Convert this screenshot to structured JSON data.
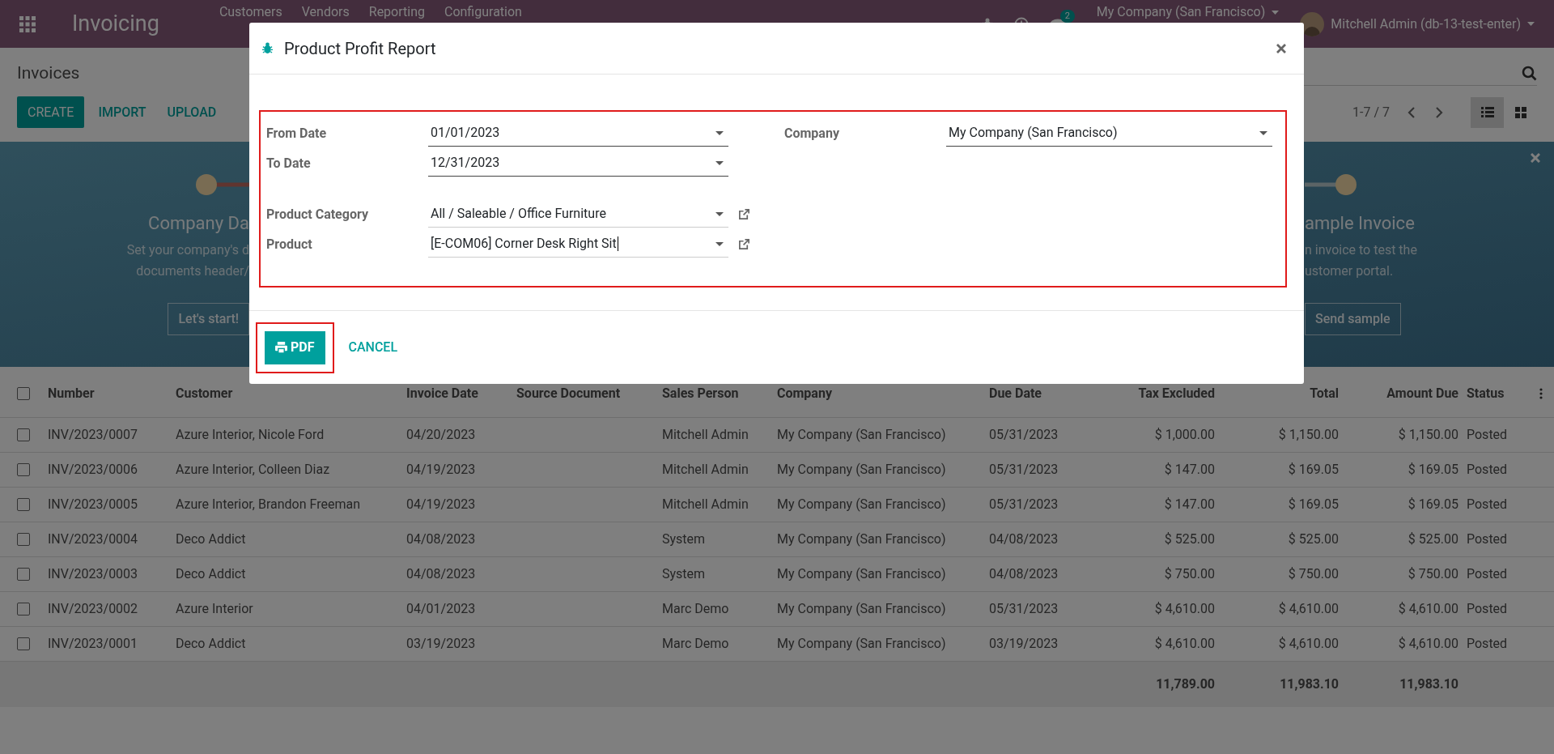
{
  "navbar": {
    "app_name": "Invoicing",
    "menu": [
      "Customers",
      "Vendors",
      "Reporting",
      "Configuration"
    ],
    "messages_badge": "2",
    "company": "My Company (San Francisco)",
    "user": "Mitchell Admin (db-13-test-enter)"
  },
  "control_panel": {
    "breadcrumb": "Invoices",
    "buttons": [
      {
        "label": "CREATE",
        "kind": "primary"
      },
      {
        "label": "IMPORT",
        "kind": "link"
      },
      {
        "label": "UPLOAD",
        "kind": "link"
      }
    ],
    "pager": "1-7 / 7",
    "views": [
      {
        "kind": "list",
        "selected": true
      },
      {
        "kind": "kanban",
        "selected": false
      }
    ]
  },
  "onboarding": {
    "steps": [
      {
        "title": "Company Da",
        "lines": [
          "Set your company's d",
          "documents header/"
        ],
        "button": "Let's start!"
      },
      {
        "title": "ample Invoice",
        "lines": [
          "n invoice to test the",
          "ustomer portal."
        ],
        "button": "Send sample"
      }
    ]
  },
  "table": {
    "all_checked": false,
    "columns": [
      {
        "label": "Number",
        "kind": "text"
      },
      {
        "label": "Customer",
        "kind": "text"
      },
      {
        "label": "Invoice Date",
        "kind": "text"
      },
      {
        "label": "Source Document",
        "kind": "text"
      },
      {
        "label": "Sales Person",
        "kind": "text"
      },
      {
        "label": "Company",
        "kind": "text"
      },
      {
        "label": "Due Date",
        "kind": "text"
      },
      {
        "label": "Tax Excluded",
        "kind": "amount"
      },
      {
        "label": "Total",
        "kind": "amount"
      },
      {
        "label": "Amount Due",
        "kind": "amount"
      },
      {
        "label": "Status",
        "kind": "text"
      }
    ],
    "rows": [
      {
        "checked": false,
        "cells": [
          "INV/2023/0007",
          "Azure Interior, Nicole Ford",
          "04/20/2023",
          "",
          "Mitchell Admin",
          "My Company (San Francisco)",
          "05/31/2023",
          "$ 1,000.00",
          "$ 1,150.00",
          "$ 1,150.00",
          "Posted"
        ]
      },
      {
        "checked": false,
        "cells": [
          "INV/2023/0006",
          "Azure Interior, Colleen Diaz",
          "04/19/2023",
          "",
          "Mitchell Admin",
          "My Company (San Francisco)",
          "05/31/2023",
          "$ 147.00",
          "$ 169.05",
          "$ 169.05",
          "Posted"
        ]
      },
      {
        "checked": false,
        "cells": [
          "INV/2023/0005",
          "Azure Interior, Brandon Freeman",
          "04/19/2023",
          "",
          "Mitchell Admin",
          "My Company (San Francisco)",
          "05/31/2023",
          "$ 147.00",
          "$ 169.05",
          "$ 169.05",
          "Posted"
        ]
      },
      {
        "checked": false,
        "cells": [
          "INV/2023/0004",
          "Deco Addict",
          "04/08/2023",
          "",
          "System",
          "My Company (San Francisco)",
          "04/08/2023",
          "$ 525.00",
          "$ 525.00",
          "$ 525.00",
          "Posted"
        ]
      },
      {
        "checked": false,
        "cells": [
          "INV/2023/0003",
          "Deco Addict",
          "04/08/2023",
          "",
          "System",
          "My Company (San Francisco)",
          "04/08/2023",
          "$ 750.00",
          "$ 750.00",
          "$ 750.00",
          "Posted"
        ]
      },
      {
        "checked": false,
        "cells": [
          "INV/2023/0002",
          "Azure Interior",
          "04/01/2023",
          "",
          "Marc Demo",
          "My Company (San Francisco)",
          "05/31/2023",
          "$ 4,610.00",
          "$ 4,610.00",
          "$ 4,610.00",
          "Posted"
        ]
      },
      {
        "checked": false,
        "cells": [
          "INV/2023/0001",
          "Deco Addict",
          "03/19/2023",
          "",
          "Marc Demo",
          "My Company (San Francisco)",
          "03/19/2023",
          "$ 4,610.00",
          "$ 4,610.00",
          "$ 4,610.00",
          "Posted"
        ]
      }
    ],
    "totals": {
      "tax_excluded": "11,789.00",
      "total": "11,983.10",
      "amount_due": "11,983.10"
    }
  },
  "dialog": {
    "title": "Product Profit Report",
    "left_groups": [
      [
        {
          "label": "From Date",
          "value": "01/01/2023",
          "kind": "date",
          "focused": false
        },
        {
          "label": "To Date",
          "value": "12/31/2023",
          "kind": "date",
          "focused": false
        }
      ],
      [
        {
          "label": "Product Category",
          "value": "All / Saleable / Office Furniture",
          "kind": "many2one",
          "focused": false
        },
        {
          "label": "Product",
          "value": "[E-COM06] Corner Desk Right Sit",
          "kind": "many2one",
          "focused": true
        }
      ]
    ],
    "right_fields": [
      {
        "label": "Company",
        "value": "My Company (San Francisco)",
        "kind": "select",
        "focused": false
      }
    ],
    "buttons": [
      {
        "label": "PDF",
        "kind": "primary"
      },
      {
        "label": "CANCEL",
        "kind": "link"
      }
    ]
  }
}
